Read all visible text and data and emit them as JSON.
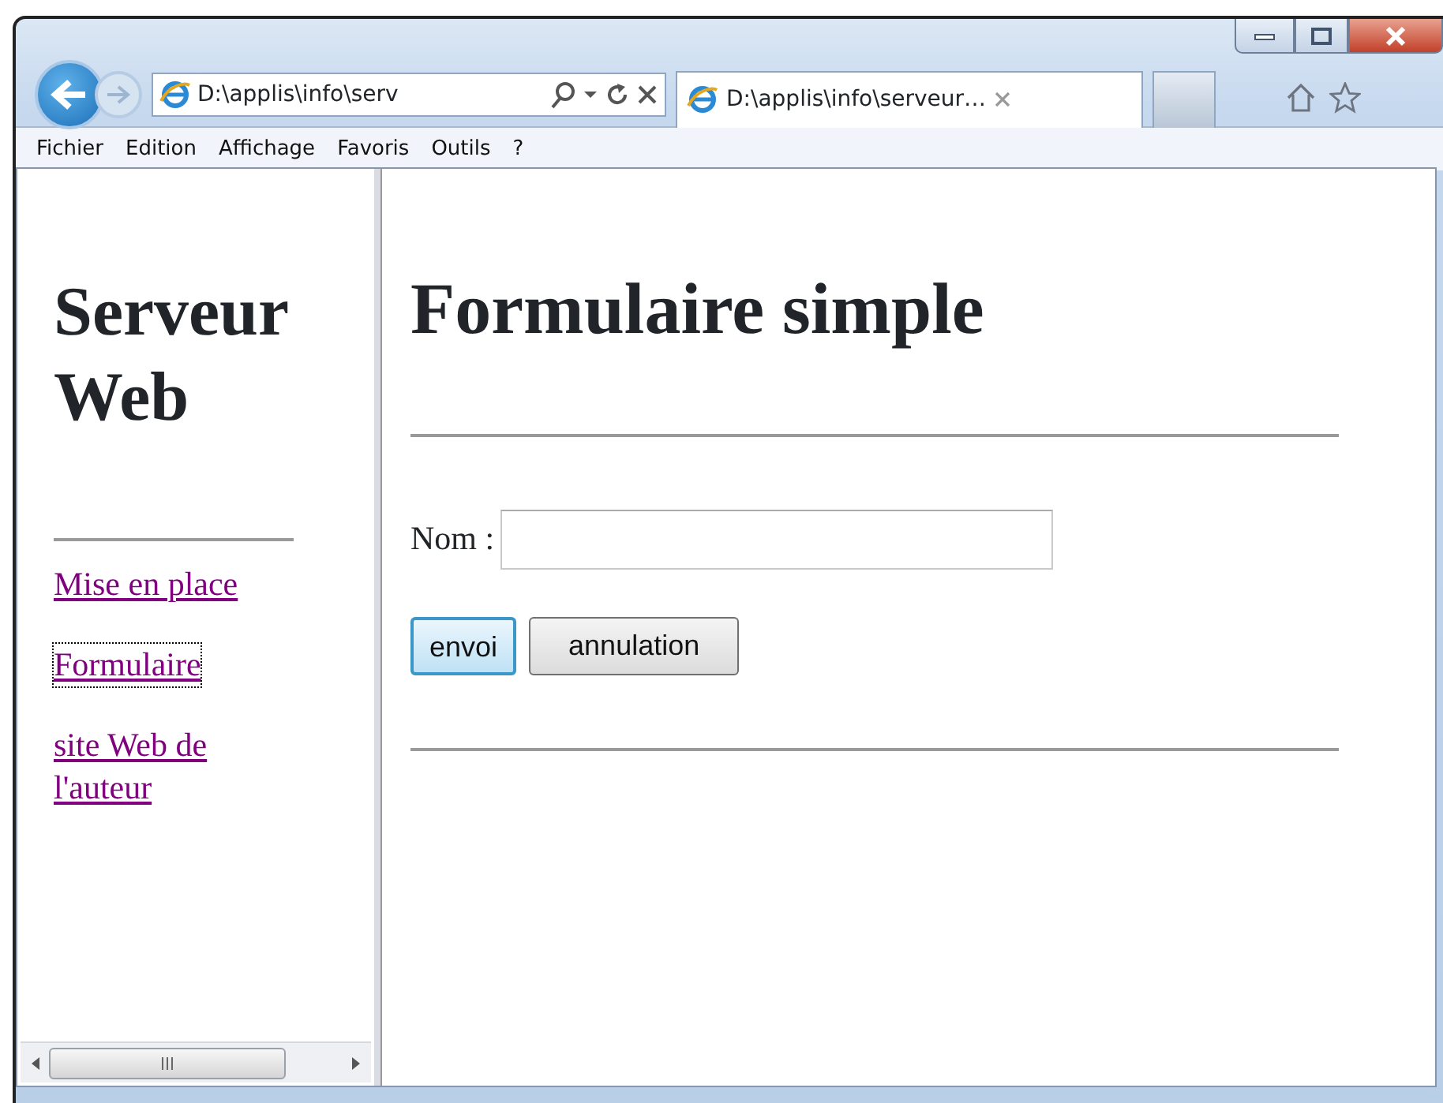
{
  "browser": {
    "address": "D:\\applis\\info\\serv",
    "tab": {
      "title": "D:\\applis\\info\\serveur…",
      "selected": true
    }
  },
  "menu": [
    "Fichier",
    "Edition",
    "Affichage",
    "Favoris",
    "Outils",
    "?"
  ],
  "left_frame": {
    "heading": "Serveur Web",
    "links": [
      {
        "label": "Mise en place",
        "focused": false
      },
      {
        "label": "Formulaire",
        "focused": true
      },
      {
        "label": "site Web de l'auteur",
        "focused": false
      }
    ]
  },
  "main_frame": {
    "heading": "Formulaire simple",
    "field": {
      "label": "Nom :"
    },
    "buttons": [
      {
        "label": "envoi",
        "default": true
      },
      {
        "label": "annulation",
        "default": false
      }
    ]
  }
}
